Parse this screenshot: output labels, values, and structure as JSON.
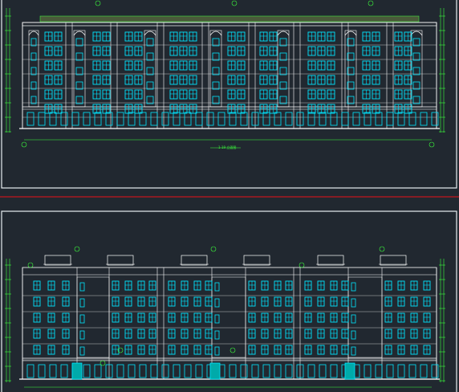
{
  "drawing": {
    "background": "#212830",
    "frame_color": "#e8eef2",
    "line_color": "#ffffff",
    "window_color": "#00e5ff",
    "dimension_color": "#3cff3c",
    "separator_color": "#c4161c"
  },
  "sheets": [
    {
      "id": "elevation-top",
      "title": "1-19 立面图"
    },
    {
      "id": "elevation-bottom",
      "title": ""
    }
  ]
}
